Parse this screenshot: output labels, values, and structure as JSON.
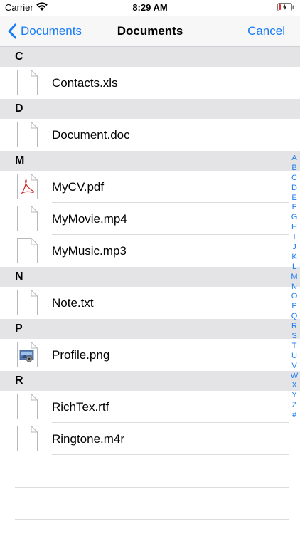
{
  "status": {
    "carrier": "Carrier",
    "time": "8:29 AM"
  },
  "nav": {
    "back_label": "Documents",
    "title": "Documents",
    "cancel_label": "Cancel"
  },
  "sections": [
    {
      "letter": "C",
      "files": [
        {
          "name": "Contacts.xls",
          "icon": "document-icon"
        }
      ]
    },
    {
      "letter": "D",
      "files": [
        {
          "name": "Document.doc",
          "icon": "document-icon"
        }
      ]
    },
    {
      "letter": "M",
      "files": [
        {
          "name": "MyCV.pdf",
          "icon": "pdf-icon"
        },
        {
          "name": "MyMovie.mp4",
          "icon": "document-icon"
        },
        {
          "name": "MyMusic.mp3",
          "icon": "document-icon"
        }
      ]
    },
    {
      "letter": "N",
      "files": [
        {
          "name": "Note.txt",
          "icon": "document-icon"
        }
      ]
    },
    {
      "letter": "P",
      "files": [
        {
          "name": "Profile.png",
          "icon": "image-file-icon"
        }
      ]
    },
    {
      "letter": "R",
      "files": [
        {
          "name": "RichTex.rtf",
          "icon": "document-icon"
        },
        {
          "name": "Ringtone.m4r",
          "icon": "document-icon"
        }
      ]
    }
  ],
  "index_letters": [
    "A",
    "B",
    "C",
    "D",
    "E",
    "F",
    "G",
    "H",
    "I",
    "J",
    "K",
    "L",
    "M",
    "N",
    "O",
    "P",
    "Q",
    "R",
    "S",
    "T",
    "U",
    "V",
    "W",
    "X",
    "Y",
    "Z",
    "#"
  ],
  "colors": {
    "accent": "#1a7cf5",
    "section_header_bg": "#e4e4e6",
    "nav_bg": "#f7f7f8",
    "battery_low": "#e5302a"
  }
}
